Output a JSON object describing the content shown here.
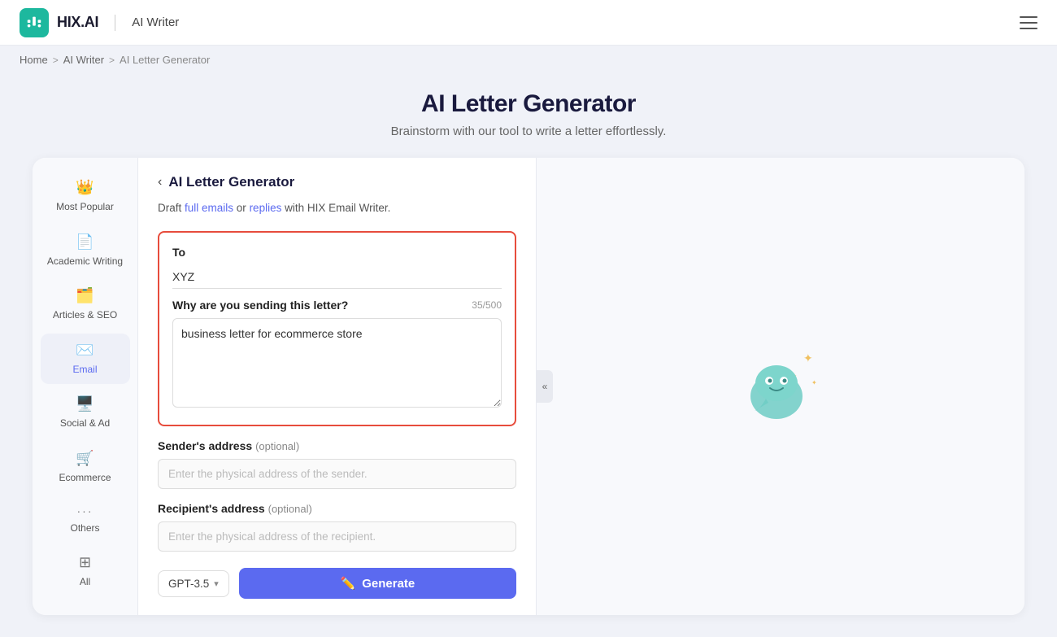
{
  "header": {
    "logo_text": "HIX.AI",
    "divider": "|",
    "subtitle": "AI Writer",
    "hamburger_label": "menu"
  },
  "breadcrumb": {
    "home": "Home",
    "ai_writer": "AI Writer",
    "current": "AI Letter Generator",
    "sep": ">"
  },
  "page_title": "AI Letter Generator",
  "page_subtitle": "Brainstorm with our tool to write a letter effortlessly.",
  "sidebar": {
    "items": [
      {
        "id": "most-popular",
        "label": "Most Popular",
        "icon": "👑"
      },
      {
        "id": "academic-writing",
        "label": "Academic Writing",
        "icon": "📄"
      },
      {
        "id": "articles-seo",
        "label": "Articles & SEO",
        "icon": "🗂️"
      },
      {
        "id": "email",
        "label": "Email",
        "icon": "✉️",
        "active": true
      },
      {
        "id": "social-ad",
        "label": "Social & Ad",
        "icon": "🖥️"
      },
      {
        "id": "ecommerce",
        "label": "Ecommerce",
        "icon": "🛒"
      },
      {
        "id": "others",
        "label": "Others",
        "icon": "···"
      },
      {
        "id": "all",
        "label": "All",
        "icon": "⊞"
      }
    ]
  },
  "tool": {
    "back_label": "‹",
    "title": "AI Letter Generator",
    "description_prefix": "Draft ",
    "link1_text": "full emails",
    "description_middle": " or ",
    "link2_text": "replies",
    "description_suffix": " with HIX Email Writer.",
    "to_label": "To",
    "to_value": "XYZ",
    "reason_label": "Why are you sending this letter?",
    "reason_char_count": "35/500",
    "reason_value": "business letter for ecommerce store",
    "sender_address_label": "Sender's address",
    "sender_optional": "(optional)",
    "sender_placeholder": "Enter the physical address of the sender.",
    "recipient_address_label": "Recipient's address",
    "recipient_optional": "(optional)",
    "recipient_placeholder": "Enter the physical address of the recipient.",
    "model_label": "GPT-3.5",
    "generate_label": "Generate",
    "generate_icon": "✏️"
  }
}
